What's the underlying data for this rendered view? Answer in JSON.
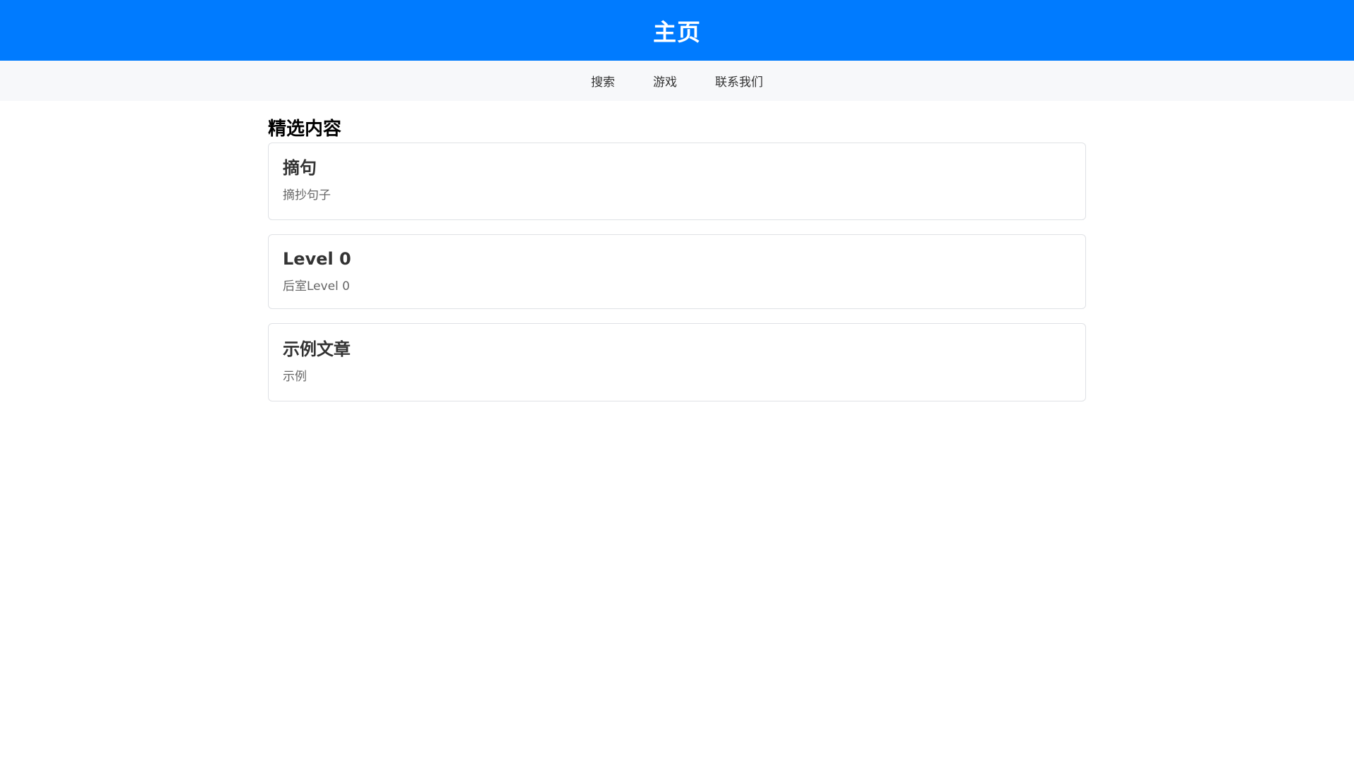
{
  "header": {
    "title": "主页"
  },
  "nav": {
    "items": [
      {
        "label": "搜索"
      },
      {
        "label": "游戏"
      },
      {
        "label": "联系我们"
      }
    ]
  },
  "main": {
    "section_title": "精选内容",
    "cards": [
      {
        "title": "摘句",
        "description": "摘抄句子"
      },
      {
        "title": "Level 0",
        "description": "后室Level 0"
      },
      {
        "title": "示例文章",
        "description": "示例"
      }
    ]
  },
  "colors": {
    "accent": "#007bff",
    "nav_background": "#f7f8fa",
    "card_border": "#dfe1e5"
  }
}
